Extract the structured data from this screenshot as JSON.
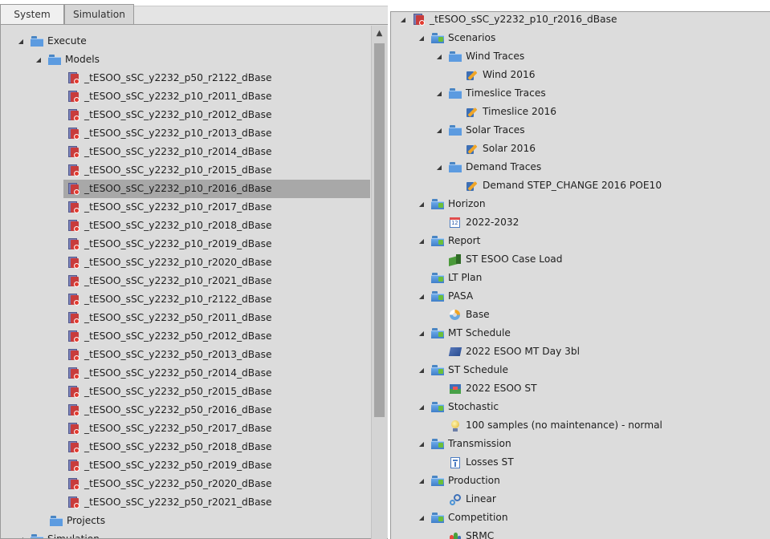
{
  "tabs": [
    {
      "label": "System",
      "active": false
    },
    {
      "label": "Simulation",
      "active": true
    }
  ],
  "left_tree": {
    "execute": "Execute",
    "models": "Models",
    "model_items": [
      "_tESOO_sSC_y2232_p50_r2122_dBase",
      "_tESOO_sSC_y2232_p10_r2011_dBase",
      "_tESOO_sSC_y2232_p10_r2012_dBase",
      "_tESOO_sSC_y2232_p10_r2013_dBase",
      "_tESOO_sSC_y2232_p10_r2014_dBase",
      "_tESOO_sSC_y2232_p10_r2015_dBase",
      "_tESOO_sSC_y2232_p10_r2016_dBase",
      "_tESOO_sSC_y2232_p10_r2017_dBase",
      "_tESOO_sSC_y2232_p10_r2018_dBase",
      "_tESOO_sSC_y2232_p10_r2019_dBase",
      "_tESOO_sSC_y2232_p10_r2020_dBase",
      "_tESOO_sSC_y2232_p10_r2021_dBase",
      "_tESOO_sSC_y2232_p10_r2122_dBase",
      "_tESOO_sSC_y2232_p50_r2011_dBase",
      "_tESOO_sSC_y2232_p50_r2012_dBase",
      "_tESOO_sSC_y2232_p50_r2013_dBase",
      "_tESOO_sSC_y2232_p50_r2014_dBase",
      "_tESOO_sSC_y2232_p50_r2015_dBase",
      "_tESOO_sSC_y2232_p50_r2016_dBase",
      "_tESOO_sSC_y2232_p50_r2017_dBase",
      "_tESOO_sSC_y2232_p50_r2018_dBase",
      "_tESOO_sSC_y2232_p50_r2019_dBase",
      "_tESOO_sSC_y2232_p50_r2020_dBase",
      "_tESOO_sSC_y2232_p50_r2021_dBase"
    ],
    "selected_model": "_tESOO_sSC_y2232_p10_r2016_dBase",
    "projects": "Projects",
    "simulation": "Simulation"
  },
  "right_tree": {
    "root": "_tESOO_sSC_y2232_p10_r2016_dBase",
    "nodes": [
      {
        "label": "Scenarios",
        "icon": "folder-gem-icon",
        "expanded": true
      },
      {
        "label": "Wind Traces",
        "icon": "folder-icon",
        "expanded": true
      },
      {
        "label": "Wind 2016",
        "icon": "trace-icon"
      },
      {
        "label": "Timeslice Traces",
        "icon": "folder-icon",
        "expanded": true
      },
      {
        "label": "Timeslice 2016",
        "icon": "trace-icon"
      },
      {
        "label": "Solar Traces",
        "icon": "folder-icon",
        "expanded": true
      },
      {
        "label": "Solar 2016",
        "icon": "trace-icon"
      },
      {
        "label": "Demand Traces",
        "icon": "folder-icon",
        "expanded": true
      },
      {
        "label": "Demand STEP_CHANGE 2016 POE10",
        "icon": "trace-icon"
      },
      {
        "label": "Horizon",
        "icon": "folder-gem-icon",
        "expanded": true
      },
      {
        "label": "2022-2032",
        "icon": "calendar-icon"
      },
      {
        "label": "Report",
        "icon": "folder-gem-icon",
        "expanded": true
      },
      {
        "label": "ST ESOO Case Load",
        "icon": "report-icon"
      },
      {
        "label": "LT Plan",
        "icon": "folder-gem-icon"
      },
      {
        "label": "PASA",
        "icon": "folder-gem-icon",
        "expanded": true
      },
      {
        "label": "Base",
        "icon": "pasa-icon"
      },
      {
        "label": "MT Schedule",
        "icon": "folder-gem-icon",
        "expanded": true
      },
      {
        "label": "2022 ESOO MT Day 3bl",
        "icon": "mt-schedule-icon"
      },
      {
        "label": "ST Schedule",
        "icon": "folder-gem-icon",
        "expanded": true
      },
      {
        "label": "2022 ESOO ST",
        "icon": "st-schedule-icon"
      },
      {
        "label": "Stochastic",
        "icon": "folder-gem-icon",
        "expanded": true
      },
      {
        "label": "100 samples (no maintenance) - normal",
        "icon": "stochastic-icon"
      },
      {
        "label": "Transmission",
        "icon": "folder-gem-icon",
        "expanded": true
      },
      {
        "label": "Losses ST",
        "icon": "transmission-icon"
      },
      {
        "label": "Production",
        "icon": "folder-gem-icon",
        "expanded": true
      },
      {
        "label": "Linear",
        "icon": "production-icon"
      },
      {
        "label": "Competition",
        "icon": "folder-gem-icon",
        "expanded": true
      },
      {
        "label": "SRMC",
        "icon": "competition-icon"
      }
    ]
  },
  "colors": {
    "panel_bg": "#dcdcdc",
    "selected_row": "#a8a8a8",
    "folder_blue": "#5c9be0",
    "db_red": "#c83c3c"
  }
}
